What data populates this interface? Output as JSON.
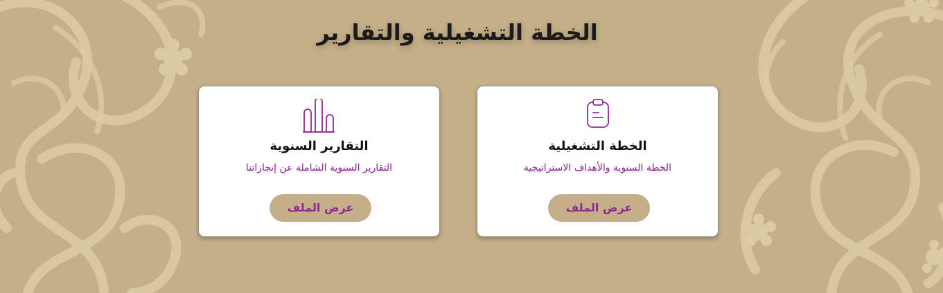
{
  "page": {
    "title": "الخطة التشغيلية والتقارير"
  },
  "cards": [
    {
      "icon": "bar-chart-icon",
      "title": "التقارير السنوية",
      "description": "التقارير السنوية الشاملة عن إنجازاتنا",
      "button_label": "عرض الملف"
    },
    {
      "icon": "clipboard-icon",
      "title": "الخطة التشغيلية",
      "description": "الخطة السنوية والأهداف الاستراتيجية",
      "button_label": "عرض الملف"
    }
  ],
  "colors": {
    "background": "#c4af89",
    "accent": "#8e2a90",
    "card": "#ffffff",
    "title": "#1b1b1b"
  }
}
